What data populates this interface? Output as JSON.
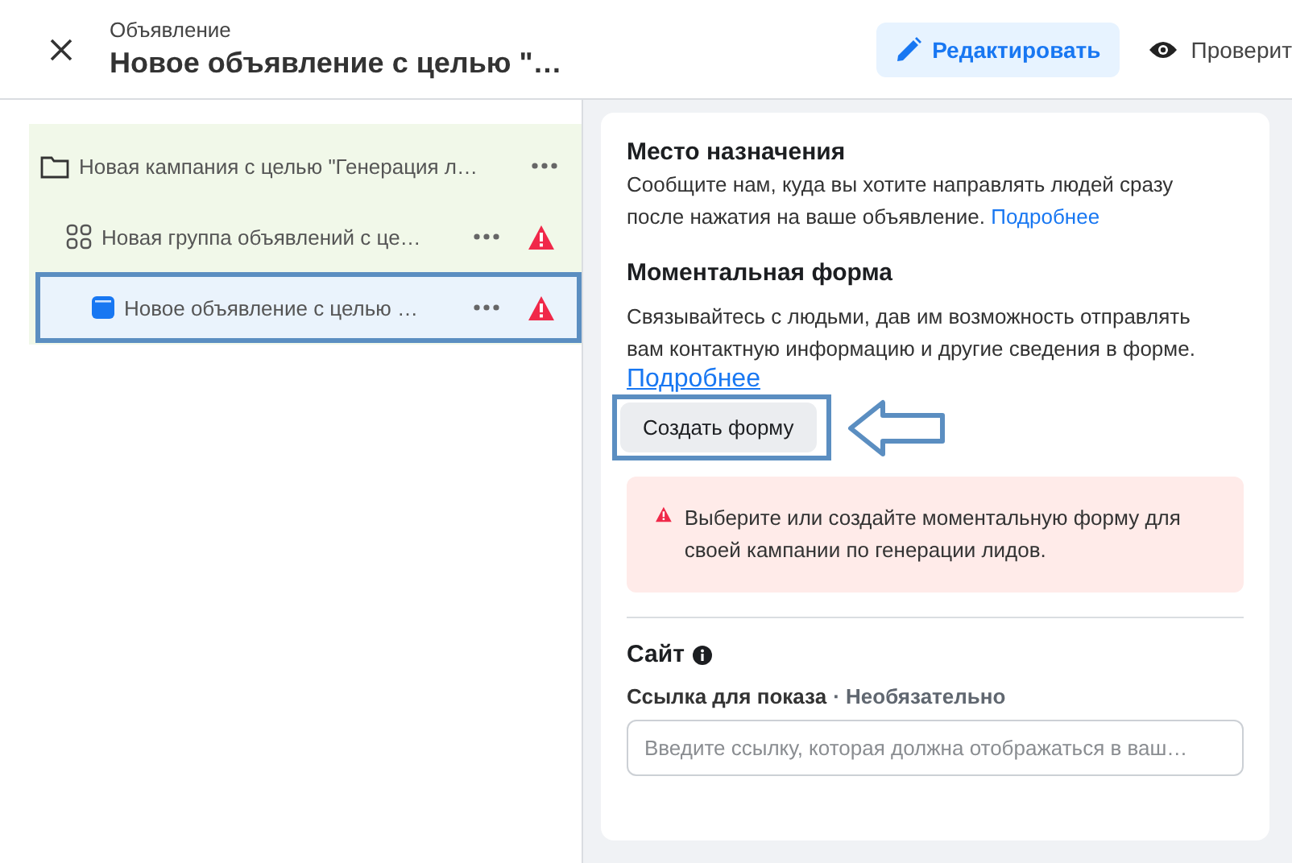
{
  "header": {
    "subtitle": "Объявление",
    "title": "Новое объявление с целью \"…",
    "edit_button": "Редактировать",
    "preview_button": "Проверит"
  },
  "tree": [
    {
      "kind": "campaign",
      "label": "Новая кампания с целью \"Генерация л…",
      "warning": false,
      "selected": false,
      "children": [
        {
          "kind": "adset",
          "label": "Новая группа объявлений с це…",
          "warning": true,
          "selected": false,
          "children": [
            {
              "kind": "ad",
              "label": "Новое объявление с целью …",
              "warning": true,
              "selected": true
            }
          ]
        }
      ]
    }
  ],
  "destination": {
    "heading": "Место назначения",
    "text": "Сообщите нам, куда вы хотите направлять людей сразу после нажатия на ваше объявление.",
    "link": "Подробнее"
  },
  "instant_form": {
    "heading": "Моментальная форма",
    "text": "Связывайтесь с людьми, дав им возможность отправлять вам контактную информацию и другие сведения в форме.",
    "link": "Подробнее",
    "button": "Создать форму",
    "highlighted": true
  },
  "alert": {
    "text": "Выберите или создайте моментальную форму для своей кампании по генерации лидов."
  },
  "website": {
    "heading": "Сайт",
    "field_label": "Ссылка для показа",
    "optional": "· Необязательно",
    "placeholder": "Введите ссылку, которая должна отображаться в ваш…"
  }
}
